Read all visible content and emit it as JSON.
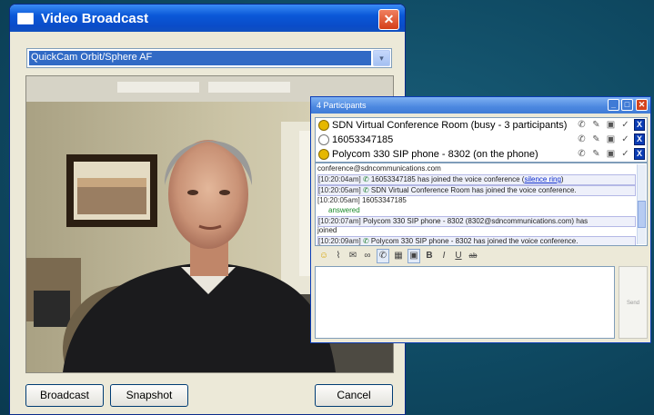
{
  "broadcast": {
    "title": "Video Broadcast",
    "close_glyph": "✕",
    "camera_selected": "QuickCam Orbit/Sphere AF",
    "dropdown_glyph": "▾",
    "buttons": {
      "broadcast": "Broadcast",
      "snapshot": "Snapshot",
      "cancel": "Cancel"
    }
  },
  "participants": {
    "title": "4 Participants",
    "window_controls": [
      "_",
      "□",
      "✕"
    ],
    "list": [
      {
        "name": "SDN Virtual Conference Room (busy - 3 participants)",
        "status": "busy"
      },
      {
        "name": "16053347185",
        "status": "idle"
      },
      {
        "name": "Polycom 330 SIP phone - 8302 (on the phone)",
        "status": "busy"
      }
    ],
    "row_actions": [
      "phone-icon",
      "pen-icon",
      "video-icon",
      "check-icon",
      "remove-icon"
    ],
    "remove_glyph": "X",
    "log": [
      {
        "text": "conference@sdncommunications.com"
      },
      {
        "ts": "[10:20:04am]",
        "text": "16053347185 has joined the voice conference",
        "link": "silence ring"
      },
      {
        "ts": "[10:20:05am]",
        "text": "SDN Virtual Conference Room has joined the voice conference."
      },
      {
        "ts": "[10:20:05am]",
        "text": "16053347185"
      },
      {
        "text": "answered"
      },
      {
        "ts": "[10:20:07am]",
        "text": "Polycom 330 SIP phone - 8302 (8302@sdncommunications.com) has"
      },
      {
        "text": "joined"
      },
      {
        "ts": "[10:20:09am]",
        "text": "Polycom 330 SIP phone - 8302 has joined the voice conference."
      }
    ],
    "toolbar": [
      "smiley-icon",
      "paperclip-icon",
      "speech-icon",
      "link-icon",
      "phone-icon",
      "image-icon",
      "camera-icon"
    ],
    "format": {
      "bold": "B",
      "italic": "I",
      "underline": "U",
      "strike": "ab"
    },
    "send_label": "Send"
  },
  "colors": {
    "desktop": "#0f4a63",
    "titlebar": "#0a4cc8",
    "busy": "#e6b800"
  }
}
